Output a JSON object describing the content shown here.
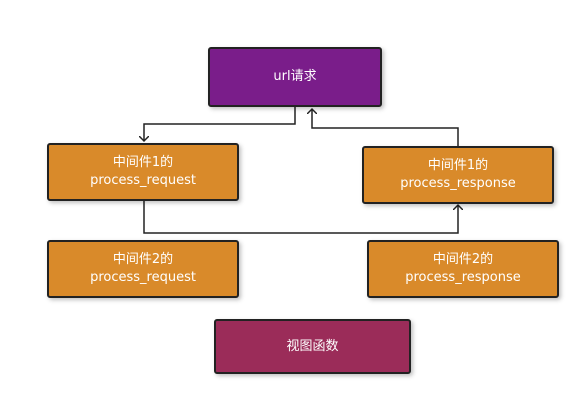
{
  "colors": {
    "url_box": "#7a1d8a",
    "middleware_box": "#d98a2a",
    "view_box": "#9b2c59",
    "border": "#222222",
    "line": "#222222"
  },
  "nodes": {
    "url_request": {
      "label": "url请求"
    },
    "mw1_request": {
      "line1": "中间件1的",
      "line2": "process_request"
    },
    "mw2_request": {
      "line1": "中间件2的",
      "line2": "process_request"
    },
    "mw1_response": {
      "line1": "中间件1的",
      "line2": "process_response"
    },
    "mw2_response": {
      "line1": "中间件2的",
      "line2": "process_response"
    },
    "view_function": {
      "label": "视图函数"
    }
  }
}
